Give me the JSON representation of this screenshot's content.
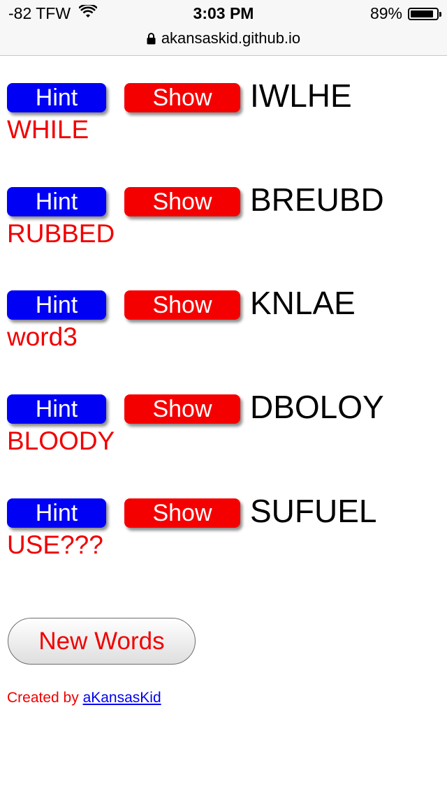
{
  "status_bar": {
    "carrier": "-82 TFW",
    "time": "3:03 PM",
    "battery_percent": "89%",
    "battery_level": 0.89,
    "url": "akansaskid.github.io"
  },
  "puzzles": [
    {
      "hint_label": "Hint",
      "show_label": "Show",
      "scrambled": "IWLHE",
      "answer": "WHILE"
    },
    {
      "hint_label": "Hint",
      "show_label": "Show",
      "scrambled": "BREUBD",
      "answer": "RUBBED"
    },
    {
      "hint_label": "Hint",
      "show_label": "Show",
      "scrambled": "KNLAE",
      "answer": "word3"
    },
    {
      "hint_label": "Hint",
      "show_label": "Show",
      "scrambled": "DBOLOY",
      "answer": "BLOODY"
    },
    {
      "hint_label": "Hint",
      "show_label": "Show",
      "scrambled": "SUFUEL",
      "answer": "USE???"
    }
  ],
  "new_words_label": "New Words",
  "footer": {
    "prefix": "Created by ",
    "link_text": "aKansasKid"
  },
  "colors": {
    "hint_button": "#0000f5",
    "show_button": "#f50000",
    "answer_text": "#f00000",
    "link": "#0000ee"
  },
  "icons": [
    "wifi-icon",
    "battery-icon",
    "lock-icon"
  ]
}
